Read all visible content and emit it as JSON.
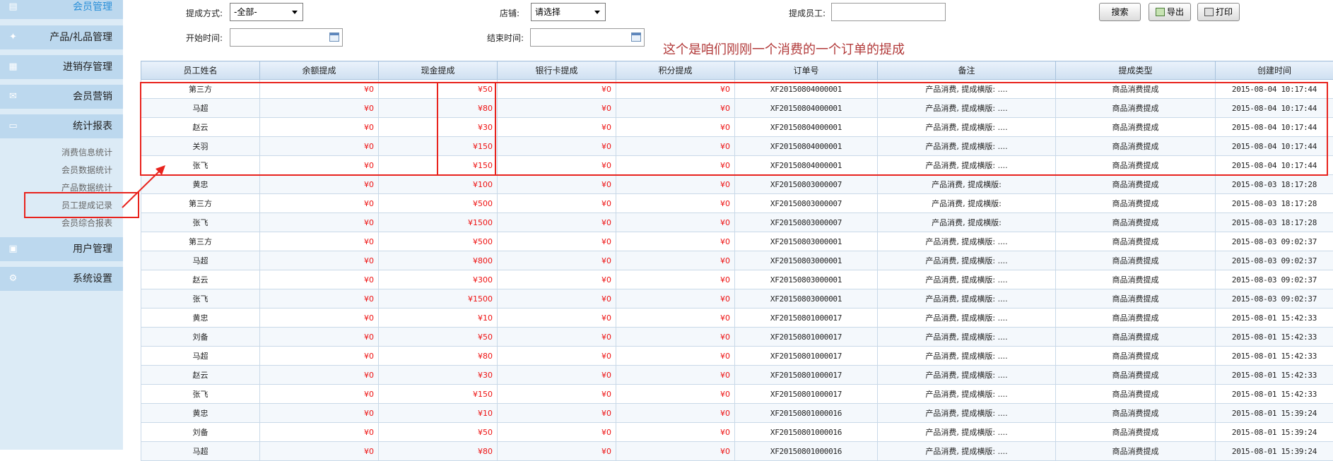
{
  "sidebar": {
    "member_mgmt": "会员管理",
    "product_gift": "产品/礼品管理",
    "inventory": "进销存管理",
    "member_marketing": "会员营销",
    "stats_reports": "统计报表",
    "sub_items": [
      "消费信息统计",
      "会员数据统计",
      "产品数据统计",
      "员工提成记录",
      "会员综合报表"
    ],
    "user_mgmt": "用户管理",
    "system_settings": "系统设置"
  },
  "filters": {
    "method_label": "提成方式:",
    "method_value": "-全部-",
    "store_label": "店铺:",
    "store_value": "请选择",
    "staff_label": "提成员工:",
    "staff_value": "",
    "start_label": "开始时间:",
    "start_value": "",
    "end_label": "结束时间:",
    "end_value": "",
    "search_btn": "搜索",
    "export_btn": "导出",
    "print_btn": "打印"
  },
  "annotation": "这个是咱们刚刚一个消费的一个订单的提成",
  "table": {
    "columns": [
      "员工姓名",
      "余额提成",
      "现金提成",
      "银行卡提成",
      "积分提成",
      "订单号",
      "备注",
      "提成类型",
      "创建时间"
    ],
    "rows": [
      [
        "第三方",
        "¥0",
        "¥50",
        "¥0",
        "¥0",
        "XF20150804000001",
        "产品消费, 提成横版: ....",
        "商品消费提成",
        "2015-08-04 10:17:44"
      ],
      [
        "马超",
        "¥0",
        "¥80",
        "¥0",
        "¥0",
        "XF20150804000001",
        "产品消费, 提成横版: ....",
        "商品消费提成",
        "2015-08-04 10:17:44"
      ],
      [
        "赵云",
        "¥0",
        "¥30",
        "¥0",
        "¥0",
        "XF20150804000001",
        "产品消费, 提成横版: ....",
        "商品消费提成",
        "2015-08-04 10:17:44"
      ],
      [
        "关羽",
        "¥0",
        "¥150",
        "¥0",
        "¥0",
        "XF20150804000001",
        "产品消费, 提成横版: ....",
        "商品消费提成",
        "2015-08-04 10:17:44"
      ],
      [
        "张飞",
        "¥0",
        "¥150",
        "¥0",
        "¥0",
        "XF20150804000001",
        "产品消费, 提成横版: ....",
        "商品消费提成",
        "2015-08-04 10:17:44"
      ],
      [
        "黄忠",
        "¥0",
        "¥100",
        "¥0",
        "¥0",
        "XF20150803000007",
        "产品消费, 提成横版:",
        "商品消费提成",
        "2015-08-03 18:17:28"
      ],
      [
        "第三方",
        "¥0",
        "¥500",
        "¥0",
        "¥0",
        "XF20150803000007",
        "产品消费, 提成横版:",
        "商品消费提成",
        "2015-08-03 18:17:28"
      ],
      [
        "张飞",
        "¥0",
        "¥1500",
        "¥0",
        "¥0",
        "XF20150803000007",
        "产品消费, 提成横版:",
        "商品消费提成",
        "2015-08-03 18:17:28"
      ],
      [
        "第三方",
        "¥0",
        "¥500",
        "¥0",
        "¥0",
        "XF20150803000001",
        "产品消费, 提成横版: ....",
        "商品消费提成",
        "2015-08-03 09:02:37"
      ],
      [
        "马超",
        "¥0",
        "¥800",
        "¥0",
        "¥0",
        "XF20150803000001",
        "产品消费, 提成横版: ....",
        "商品消费提成",
        "2015-08-03 09:02:37"
      ],
      [
        "赵云",
        "¥0",
        "¥300",
        "¥0",
        "¥0",
        "XF20150803000001",
        "产品消费, 提成横版: ....",
        "商品消费提成",
        "2015-08-03 09:02:37"
      ],
      [
        "张飞",
        "¥0",
        "¥1500",
        "¥0",
        "¥0",
        "XF20150803000001",
        "产品消费, 提成横版: ....",
        "商品消费提成",
        "2015-08-03 09:02:37"
      ],
      [
        "黄忠",
        "¥0",
        "¥10",
        "¥0",
        "¥0",
        "XF20150801000017",
        "产品消费, 提成横版: ....",
        "商品消费提成",
        "2015-08-01 15:42:33"
      ],
      [
        "刘备",
        "¥0",
        "¥50",
        "¥0",
        "¥0",
        "XF20150801000017",
        "产品消费, 提成横版: ....",
        "商品消费提成",
        "2015-08-01 15:42:33"
      ],
      [
        "马超",
        "¥0",
        "¥80",
        "¥0",
        "¥0",
        "XF20150801000017",
        "产品消费, 提成横版: ....",
        "商品消费提成",
        "2015-08-01 15:42:33"
      ],
      [
        "赵云",
        "¥0",
        "¥30",
        "¥0",
        "¥0",
        "XF20150801000017",
        "产品消费, 提成横版: ....",
        "商品消费提成",
        "2015-08-01 15:42:33"
      ],
      [
        "张飞",
        "¥0",
        "¥150",
        "¥0",
        "¥0",
        "XF20150801000017",
        "产品消费, 提成横版: ....",
        "商品消费提成",
        "2015-08-01 15:42:33"
      ],
      [
        "黄忠",
        "¥0",
        "¥10",
        "¥0",
        "¥0",
        "XF20150801000016",
        "产品消费, 提成横版: ....",
        "商品消费提成",
        "2015-08-01 15:39:24"
      ],
      [
        "刘备",
        "¥0",
        "¥50",
        "¥0",
        "¥0",
        "XF20150801000016",
        "产品消费, 提成横版: ....",
        "商品消费提成",
        "2015-08-01 15:39:24"
      ],
      [
        "马超",
        "¥0",
        "¥80",
        "¥0",
        "¥0",
        "XF20150801000016",
        "产品消费, 提成横版: ....",
        "商品消费提成",
        "2015-08-01 15:39:24"
      ]
    ]
  },
  "colors": {
    "highlight": "#e8231d",
    "money": "#ee1111",
    "sidebar_bg": "#dcebf6",
    "nav_bg": "#bcd8ee",
    "active_nav": "#2a8fd8"
  }
}
